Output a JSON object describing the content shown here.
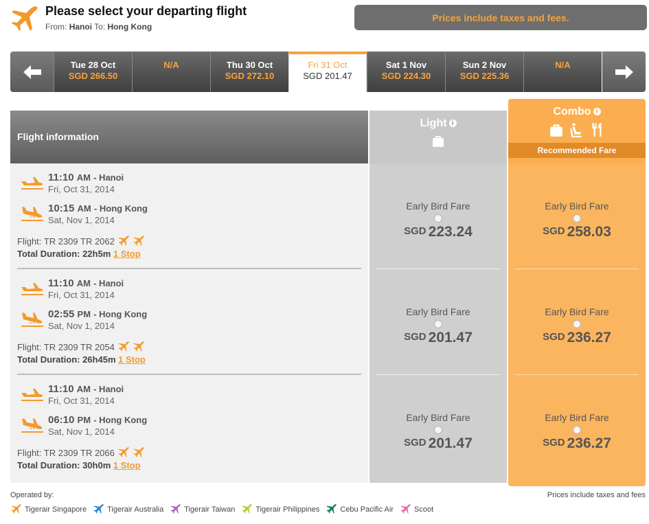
{
  "header": {
    "title": "Please select your departing flight",
    "from_label": "From:",
    "from_city": "Hanoi",
    "to_label": "To:",
    "to_city": "Hong Kong",
    "price_note": "Prices include taxes and fees."
  },
  "colors": {
    "accent": "#f7a23b",
    "combo_bg": "#fbb55f",
    "light_bg": "#cfcfcf",
    "dark_bar": "#5a5a5a"
  },
  "date_bar": {
    "days": [
      {
        "label": "Tue 28 Oct",
        "price": "SGD 266.50"
      },
      {
        "label": "N/A",
        "price": ""
      },
      {
        "label": "Thu 30 Oct",
        "price": "SGD 272.10"
      },
      {
        "label": "Fri 31 Oct",
        "price": "SGD 201.47"
      },
      {
        "label": "Sat 1 Nov",
        "price": "SGD 224.30"
      },
      {
        "label": "Sun 2 Nov",
        "price": "SGD 225.36"
      },
      {
        "label": "N/A",
        "price": ""
      }
    ],
    "selected_index": 3,
    "prev_icon": "arrow-left-icon",
    "next_icon": "arrow-right-icon"
  },
  "table": {
    "info_header": "Flight information",
    "light": {
      "title": "Light",
      "icons": [
        "baggage-icon"
      ]
    },
    "combo": {
      "title": "Combo",
      "icons": [
        "baggage-icon",
        "seat-icon",
        "meal-icon"
      ],
      "recommended": "Recommended Fare"
    },
    "flights": [
      {
        "dep_time": "11:10",
        "dep_ampm": "AM",
        "dep_city": "- Hanoi",
        "dep_date": "Fri, Oct 31, 2014",
        "arr_time": "10:15",
        "arr_ampm": "AM",
        "arr_city": "- Hong Kong",
        "arr_date": "Sat, Nov 1, 2014",
        "flight": "Flight: TR 2309 TR 2062",
        "duration_label": "Total Duration: 22h5m",
        "stops": "1 Stop",
        "light_fare": "Early Bird Fare",
        "light_cur": "SGD",
        "light_price": "223.24",
        "combo_fare": "Early Bird Fare",
        "combo_cur": "SGD",
        "combo_price": "258.03"
      },
      {
        "dep_time": "11:10",
        "dep_ampm": "AM",
        "dep_city": "- Hanoi",
        "dep_date": "Fri, Oct 31, 2014",
        "arr_time": "02:55",
        "arr_ampm": "PM",
        "arr_city": "- Hong Kong",
        "arr_date": "Sat, Nov 1, 2014",
        "flight": "Flight: TR 2309 TR 2054",
        "duration_label": "Total Duration: 26h45m",
        "stops": "1 Stop",
        "light_fare": "Early Bird Fare",
        "light_cur": "SGD",
        "light_price": "201.47",
        "combo_fare": "Early Bird Fare",
        "combo_cur": "SGD",
        "combo_price": "236.27"
      },
      {
        "dep_time": "11:10",
        "dep_ampm": "AM",
        "dep_city": "- Hanoi",
        "dep_date": "Fri, Oct 31, 2014",
        "arr_time": "06:10",
        "arr_ampm": "PM",
        "arr_city": "- Hong Kong",
        "arr_date": "Sat, Nov 1, 2014",
        "flight": "Flight: TR 2309 TR 2066",
        "duration_label": "Total Duration: 30h0m",
        "stops": "1 Stop",
        "light_fare": "Early Bird Fare",
        "light_cur": "SGD",
        "light_price": "201.47",
        "combo_fare": "Early Bird Fare",
        "combo_cur": "SGD",
        "combo_price": "236.27"
      }
    ]
  },
  "footer": {
    "operated_by": "Operated by:",
    "tax_note": "Prices include taxes and fees",
    "airlines": [
      {
        "name": "Tigerair Singapore",
        "color": "#f39a2c"
      },
      {
        "name": "Tigerair Australia",
        "color": "#2b7fd6"
      },
      {
        "name": "Tigerair Taiwan",
        "color": "#b05fc0"
      },
      {
        "name": "Tigerair Philippines",
        "color": "#b8c82a"
      },
      {
        "name": "Cebu Pacific Air",
        "color": "#0f7a5a"
      },
      {
        "name": "Scoot",
        "color": "#e56aa8"
      }
    ]
  }
}
